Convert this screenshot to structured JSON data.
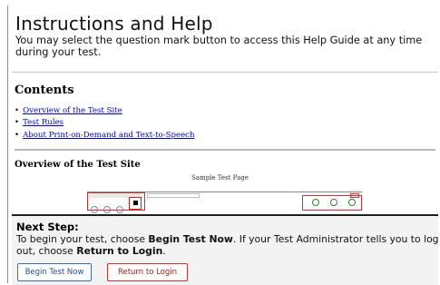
{
  "header": {
    "title": "Instructions and Help",
    "subtitle": "You may select the question mark button to access this Help Guide at any time during your test."
  },
  "contents": {
    "heading": "Contents",
    "links": [
      "Overview of the Test Site",
      "Test Rules",
      "About Print-on-Demand and Text-to-Speech"
    ]
  },
  "overview": {
    "heading": "Overview of the Test Site",
    "sample_caption": "Sample Test Page"
  },
  "next_step": {
    "heading": "Next Step:",
    "line1_prefix": "To begin your test, choose ",
    "line1_bold": "Begin Test Now",
    "line1_suffix": ". If your Test Administrator tells you to log",
    "line2_prefix": "out, choose ",
    "line2_bold": "Return to Login",
    "line2_suffix": "."
  },
  "buttons": {
    "begin": "Begin Test Now",
    "return": "Return to Login"
  },
  "colors": {
    "link": "#0000cc",
    "begin_border": "#3b6ea6",
    "return_border": "#cc3333"
  }
}
